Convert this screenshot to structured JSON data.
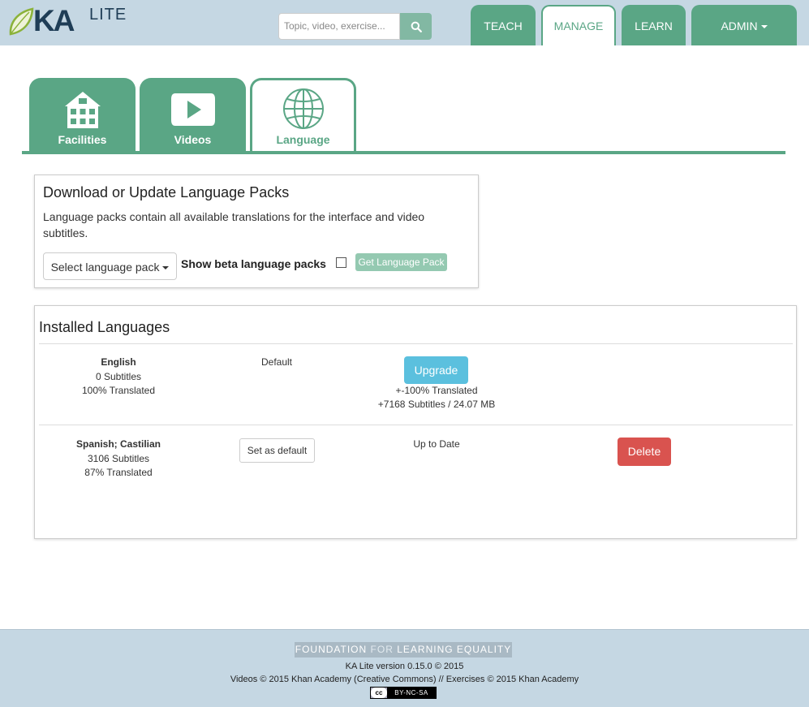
{
  "logo": {
    "ka": "KA",
    "lite": "LITE"
  },
  "search": {
    "placeholder": "Topic, video, exercise..."
  },
  "nav": {
    "teach": "TEACH",
    "manage": "MANAGE",
    "learn": "LEARN",
    "admin": "ADMIN",
    "active": "MANAGE"
  },
  "admin_tabs": [
    {
      "label": "Facilities",
      "icon": "building-icon"
    },
    {
      "label": "Videos",
      "icon": "play-icon"
    },
    {
      "label": "Language",
      "icon": "globe-icon",
      "active": true
    }
  ],
  "download": {
    "title": "Download or Update Language Packs",
    "description": "Language packs contain all available translations for the interface and video subtitles.",
    "select_label": "Select language pack",
    "beta_label": "Show beta language packs",
    "beta_checked": false,
    "get_button": "Get Language Pack"
  },
  "installed": {
    "title": "Installed Languages",
    "languages": [
      {
        "name": "English",
        "subtitles": "0 Subtitles",
        "translated": "100% Translated",
        "status": "Default",
        "upgrade_button": "Upgrade",
        "upgrade_translated": "+-100% Translated",
        "upgrade_size": "+7168 Subtitles / 24.07 MB"
      },
      {
        "name": "Spanish; Castilian",
        "subtitles": "3106 Subtitles",
        "translated": "87% Translated",
        "default_button": "Set as default",
        "status": "Up to Date",
        "delete_button": "Delete"
      }
    ]
  },
  "footer": {
    "fle_part1": "FOUNDATION",
    "fle_part2": "FOR",
    "fle_part3": "LEARNING EQUALITY",
    "version": "KA Lite version 0.15.0 © 2015",
    "credits": "Videos © 2015 Khan Academy (Creative Commons) // Exercises © 2015 Khan Academy",
    "license_mark": "cc",
    "license": "BY-NC-SA"
  },
  "colors": {
    "brand_green": "#5aa685",
    "topbar": "#c5d7e3",
    "info_button": "#5bc0de",
    "danger_button": "#d9534f"
  }
}
